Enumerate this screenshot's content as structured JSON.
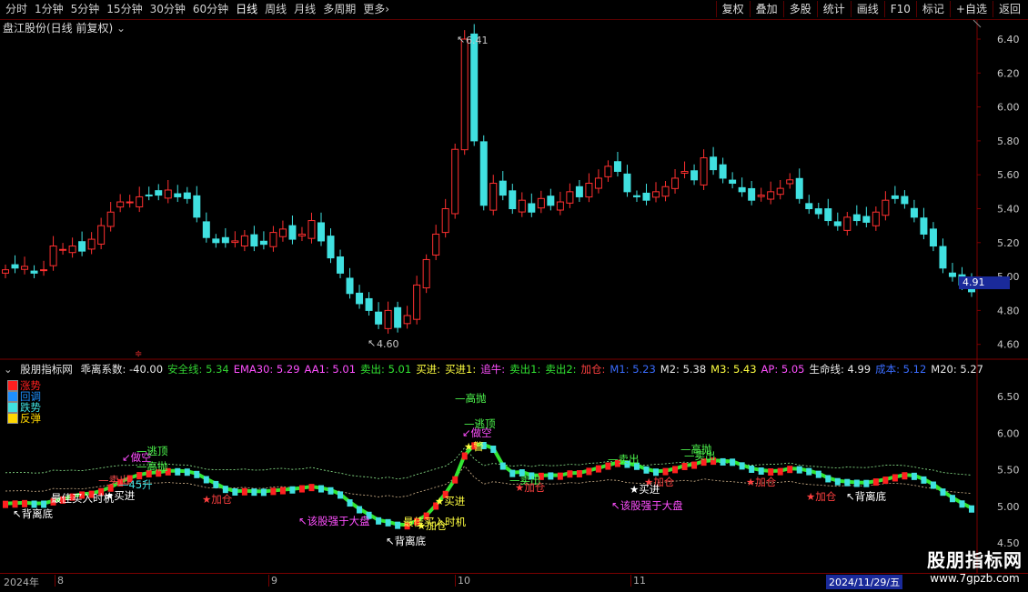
{
  "toolbar": {
    "periods": [
      "分时",
      "1分钟",
      "5分钟",
      "15分钟",
      "30分钟",
      "60分钟",
      "日线",
      "周线",
      "月线",
      "多周期",
      "更多"
    ],
    "active_period": "日线",
    "more_arrow": "›",
    "actions": [
      "复权",
      "叠加",
      "多股",
      "统计",
      "画线",
      "F10",
      "标记",
      "+自选",
      "返回"
    ]
  },
  "title": {
    "stock": "盘江股份(日线 前复权)",
    "collapse_icon": "⌄"
  },
  "price_axis": {
    "labels": [
      "6.40",
      "6.20",
      "6.00",
      "5.80",
      "5.60",
      "5.40",
      "5.20",
      "5.00",
      "4.80",
      "4.60"
    ],
    "current_price": "4.91",
    "high_label": "6.41",
    "low_label": "4.60"
  },
  "indicator": {
    "name": "股朋指标网",
    "values": [
      {
        "text": "乖离系数: -40.00",
        "color": "#e8e8e8"
      },
      {
        "text": "安全线: 5.34",
        "color": "#32d232"
      },
      {
        "text": "EMA30: 5.29",
        "color": "#ff50ff"
      },
      {
        "text": "AA1: 5.01",
        "color": "#ff50ff"
      },
      {
        "text": "卖出: 5.01",
        "color": "#32e632"
      },
      {
        "text": "买进:",
        "color": "#ffff40"
      },
      {
        "text": "买进1:",
        "color": "#ffff40"
      },
      {
        "text": "追牛:",
        "color": "#ff50ff"
      },
      {
        "text": "卖出1:",
        "color": "#32e632"
      },
      {
        "text": "卖出2:",
        "color": "#32e632"
      },
      {
        "text": "加仓:",
        "color": "#ff4040"
      },
      {
        "text": "M1: 5.23",
        "color": "#3a6cff"
      },
      {
        "text": "M2: 5.38",
        "color": "#e8e8e8"
      },
      {
        "text": "M3: 5.43",
        "color": "#ffff40"
      },
      {
        "text": "AP: 5.05",
        "color": "#ff50ff"
      },
      {
        "text": "生命线: 4.99",
        "color": "#e8e8e8"
      },
      {
        "text": "成本: 5.12",
        "color": "#3a6cff"
      },
      {
        "text": "M20: 5.27",
        "color": "#e8e8e8"
      }
    ],
    "legend": [
      {
        "label": "涨势",
        "color": "#ff2020"
      },
      {
        "label": "回调",
        "color": "#1e90ff"
      },
      {
        "label": "跌势",
        "color": "#40e0e0"
      },
      {
        "label": "反弹",
        "color": "#ffd700"
      }
    ],
    "axis_labels": [
      "6.50",
      "6.00",
      "5.50",
      "5.00",
      "4.50"
    ]
  },
  "annotations": [
    {
      "text": "↖背离底",
      "color": "#ffffff"
    },
    {
      "text": "最佳买入时机",
      "color": "#ffffff"
    },
    {
      "text": "★买进",
      "color": "#ffffff"
    },
    {
      "text": "★加仓",
      "color": "#ff4040"
    },
    {
      "text": "—卖出",
      "color": "#ff5050"
    },
    {
      "text": "—45升",
      "color": "#40e0e0"
    },
    {
      "text": "↙做空",
      "color": "#ff50ff"
    },
    {
      "text": "—逃顶",
      "color": "#50ff50"
    },
    {
      "text": "—高抛",
      "color": "#50ff50"
    },
    {
      "text": "↖该股强于大盘",
      "color": "#ff50ff"
    },
    {
      "text": "↖背离底",
      "color": "#ffffff"
    },
    {
      "text": "最佳买入时机",
      "color": "#ffff40"
    },
    {
      "text": "★加仓",
      "color": "#ffff40"
    },
    {
      "text": "★买进",
      "color": "#ffff40"
    },
    {
      "text": "—高抛",
      "color": "#50ff50"
    },
    {
      "text": "—逃顶",
      "color": "#50ff50"
    },
    {
      "text": "↙做空",
      "color": "#ff50ff"
    },
    {
      "text": "★警",
      "color": "#ffff40"
    },
    {
      "text": "—卖出",
      "color": "#50ff50"
    },
    {
      "text": "★加仓",
      "color": "#ff4040"
    },
    {
      "text": "—卖出",
      "color": "#50ff50"
    },
    {
      "text": "★加仓",
      "color": "#ff4040"
    },
    {
      "text": "—高抛",
      "color": "#50ff50"
    },
    {
      "text": "—卖出",
      "color": "#50ff50"
    },
    {
      "text": "★买进",
      "color": "#ffffff"
    },
    {
      "text": "↖该股强于大盘",
      "color": "#ff50ff"
    },
    {
      "text": "★加仓",
      "color": "#ff4040"
    },
    {
      "text": "★加仓",
      "color": "#ff4040"
    },
    {
      "text": "↖背离底",
      "color": "#ffffff"
    }
  ],
  "x_axis": {
    "labels": [
      "2024年",
      "8",
      "9",
      "10",
      "11"
    ],
    "cursor_date": "2024/11/29/五"
  },
  "watermark": {
    "line1": "股朋指标网",
    "line2": "www.7gpzb.com"
  },
  "colors": {
    "up": "#ff3030",
    "down": "#40e0e0",
    "grid": "#7a0000",
    "accent": "#1a2a9a"
  }
}
